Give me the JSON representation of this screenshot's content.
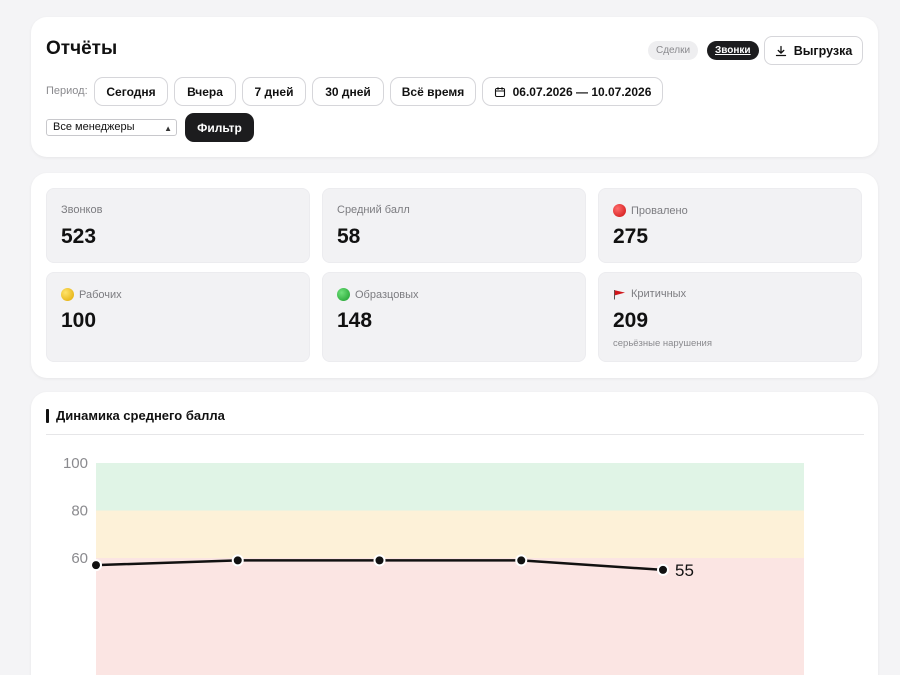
{
  "header": {
    "title": "Отчёты",
    "segments": [
      "Сделки",
      "Звонки"
    ],
    "active_segment": "Звонки",
    "export_label": "Выгрузка",
    "period_label": "Период:",
    "period_buttons": [
      "Сегодня",
      "Вчера",
      "7 дней",
      "30 дней",
      "Всё время"
    ],
    "date_range": "06.07.2026 — 10.07.2026",
    "manager_select": "Все менеджеры",
    "filter_label": "Фильтр"
  },
  "stats": [
    {
      "label": "Звонков",
      "value": "523",
      "icon": "none"
    },
    {
      "label": "Средний балл",
      "value": "58",
      "icon": "none"
    },
    {
      "label": "Провалено",
      "value": "275",
      "icon": "red-circle-icon"
    },
    {
      "label": "Рабочих",
      "value": "100",
      "icon": "yellow-circle-icon"
    },
    {
      "label": "Образцовых",
      "value": "148",
      "icon": "green-circle-icon"
    },
    {
      "label": "Критичных",
      "value": "209",
      "icon": "red-flag-icon",
      "sub": "серьёзные нарушения"
    }
  ],
  "colors": {
    "accent": "#1c1c1e",
    "zone_good": "#e0f4e6",
    "zone_mid": "#fdf1d8",
    "zone_bad": "#fbe5e3"
  },
  "chart_data": {
    "type": "line",
    "title": "Динамика среднего балла",
    "y_ticks": [
      "100",
      "80",
      "60"
    ],
    "ylim": [
      0,
      100
    ],
    "zones": [
      {
        "from": 80,
        "to": 100,
        "color": "#e0f4e6"
      },
      {
        "from": 60,
        "to": 80,
        "color": "#fdf1d8"
      },
      {
        "from": 0,
        "to": 60,
        "color": "#fbe5e3"
      }
    ],
    "series": [
      {
        "values": [
          57,
          59,
          59,
          59,
          55
        ],
        "last_label": "55"
      }
    ]
  }
}
